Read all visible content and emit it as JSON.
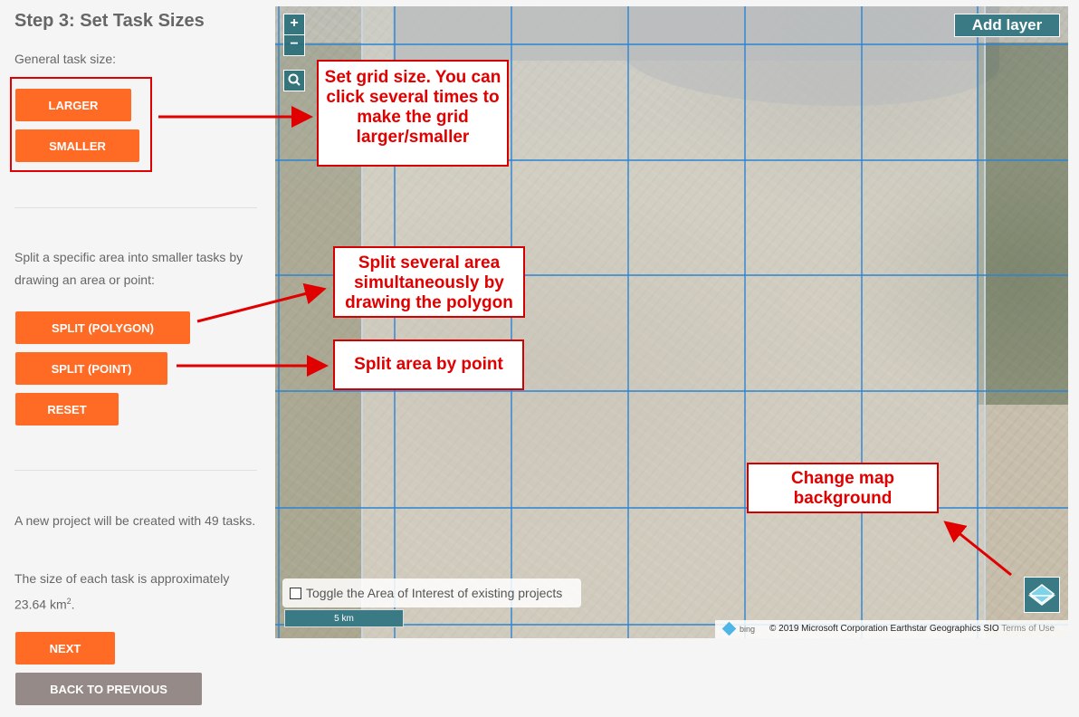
{
  "sidebar": {
    "title": "Step 3: Set Task Sizes",
    "general_label": "General task size:",
    "larger": "LARGER",
    "smaller": "SMALLER",
    "split_desc": "Split a specific area into smaller tasks by drawing an area or point:",
    "split_polygon": "SPLIT (POLYGON)",
    "split_point": "SPLIT (POINT)",
    "reset": "RESET",
    "summary_prefix": "A new project will be created with",
    "task_count": "49",
    "summary_suffix": "tasks.",
    "size_prefix": "The size of each task is approximately",
    "size_value": "23.64",
    "size_unit": "km",
    "size_exponent": "2",
    "next": "NEXT",
    "back": "BACK TO PREVIOUS"
  },
  "map": {
    "zoom_in": "+",
    "zoom_out": "−",
    "add_layer": "Add layer",
    "toggle_label": "Toggle the Area of Interest of existing projects",
    "scale_label": "5 km",
    "bing_label": "bing",
    "attribution": "© 2019 Microsoft Corporation Earthstar Geographics SIO",
    "terms": "Terms of Use",
    "icons": [
      "search-icon",
      "layers-icon",
      "bing-logo-icon"
    ]
  },
  "callouts": {
    "grid_size": "Set grid size. You can click several times to make the grid larger/smaller",
    "split_polygon": "Split several area simultaneously by drawing the polygon",
    "split_point": "Split area by point",
    "change_bg": "Change map background"
  },
  "colors": {
    "primary_button": "#ff6b25",
    "secondary_button": "#958a88",
    "annotation": "#e00000",
    "map_control": "#3a7a85",
    "grid_line": "#2a84d4"
  }
}
